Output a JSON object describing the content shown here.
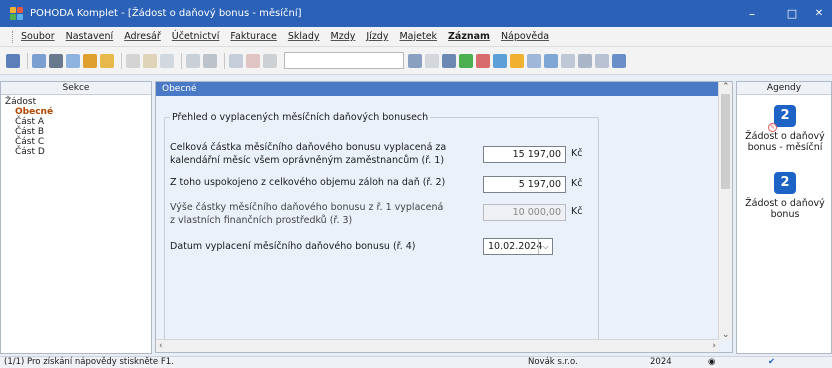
{
  "window": {
    "title": "POHODA Komplet - [Žádost o daňový bonus - měsíční]",
    "minimize": "–",
    "maximize": "□",
    "close": "✕"
  },
  "menu": [
    "Soubor",
    "Nastavení",
    "Adresář",
    "Účetnictví",
    "Fakturace",
    "Sklady",
    "Mzdy",
    "Jízdy",
    "Majetek",
    "Záznam",
    "Nápověda"
  ],
  "sekce": {
    "header": "Sekce",
    "root": "Žádost",
    "items": [
      "Obecné",
      "Část A",
      "Část B",
      "Část C",
      "Část D"
    ]
  },
  "main": {
    "header": "Obecné",
    "group_title": "Přehled o vyplacených měsíčních daňových bonusech",
    "fields": [
      {
        "label1": "Celková částka měsíčního daňového bonusu vyplacená za",
        "label2": "kalendářní měsíc všem oprávněným zaměstnancům (ř. 1)",
        "value": "15 197,00",
        "unit": "Kč"
      },
      {
        "label1": "Z toho uspokojeno z celkového objemu záloh na daň (ř. 2)",
        "label2": "",
        "value": "5 197,00",
        "unit": "Kč"
      },
      {
        "label1": "Výše částky měsíčního daňového bonusu z ř. 1 vyplacená",
        "label2": "z vlastních finančních prostředků (ř. 3)",
        "value": "10 000,00",
        "unit": "Kč"
      }
    ],
    "date_label": "Datum vyplacení měsíčního daňového bonusu (ř. 4)",
    "date_value": "10.02.2024"
  },
  "agendy": {
    "header": "Agendy",
    "items": [
      {
        "line1": "Žádost o daňový",
        "line2": "bonus - měsíční"
      },
      {
        "line1": "Žádost o daňový",
        "line2": "bonus"
      }
    ]
  },
  "status": {
    "help": "(1/1) Pro získání nápovědy stiskněte F1.",
    "company": "Novák s.r.o.",
    "year": "2024"
  }
}
